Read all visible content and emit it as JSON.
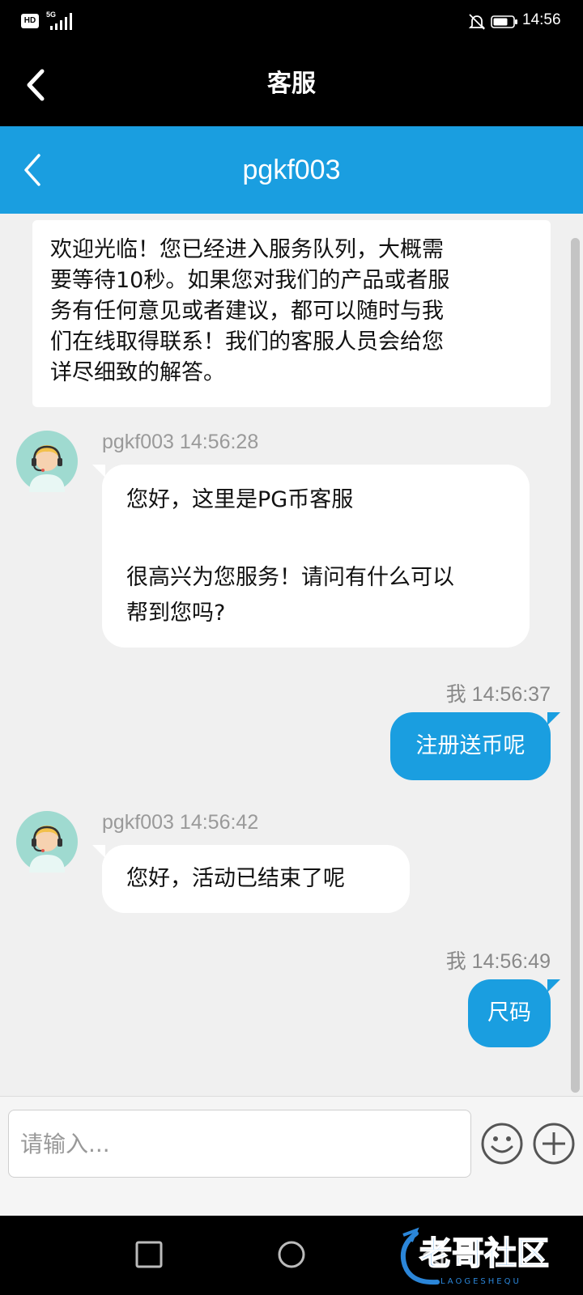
{
  "status_bar": {
    "hd": "HD",
    "network": "5G",
    "time": "14:56"
  },
  "app_header": {
    "title": "客服",
    "back_icon": "chevron-left-icon"
  },
  "chat_header": {
    "title": "pgkf003",
    "back_icon": "chevron-left-icon",
    "color": "#1a9ee0"
  },
  "welcome": {
    "lines": [
      "欢迎光临！您已经进入服务队列，大概需",
      "要等待10秒。如果您对我们的产品或者服",
      "务有任何意见或者建议，都可以随时与我",
      "们在线取得联系！我们的客服人员会给您",
      "详尽细致的解答。"
    ]
  },
  "messages": [
    {
      "from": "agent",
      "header": "pgkf003 14:56:28",
      "lines": [
        "您好，这里是PG币客服",
        "",
        "很高兴为您服务！请问有什么可以",
        "帮到您吗?"
      ]
    },
    {
      "from": "me",
      "header": "我 14:56:37",
      "text": "注册送币呢"
    },
    {
      "from": "agent",
      "header": "pgkf003 14:56:42",
      "text": "您好，活动已结束了呢"
    },
    {
      "from": "me",
      "header": "我 14:56:49",
      "text": "尺码"
    }
  ],
  "input": {
    "placeholder": "请输入...",
    "emoji_icon": "smiley-icon",
    "plus_icon": "plus-circle-icon"
  },
  "nav": {
    "icons": [
      "back-triangle-icon",
      "home-circle-icon",
      "recents-square-icon"
    ]
  },
  "watermark": {
    "text": "老哥社区",
    "subtext": "LAOGESHEQU"
  }
}
